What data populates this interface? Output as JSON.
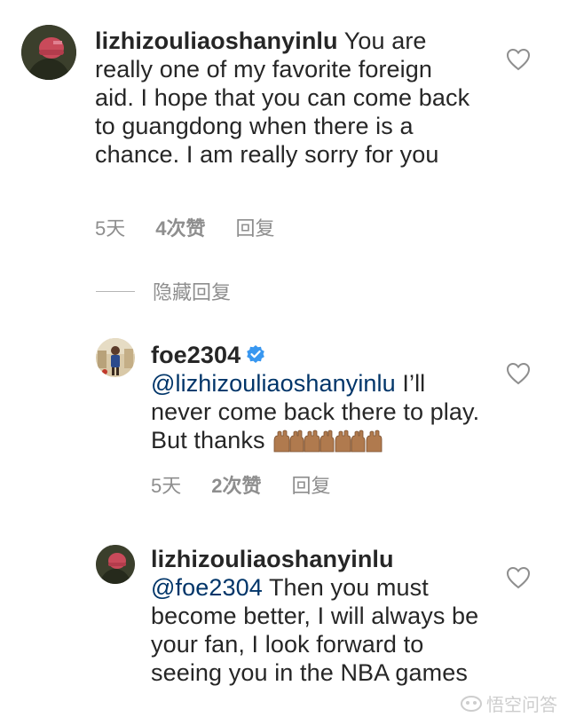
{
  "comments": [
    {
      "username": "lizhizouliaoshanyinlu",
      "mention": "",
      "text": "You are really one of my favorite foreign aid. I hope that you can come back to guangdong when there is a chance. I am really sorry for you",
      "time": "5天",
      "likes": "4次赞",
      "reply": "回复"
    },
    {
      "username": "foe2304",
      "verified": true,
      "mention": "@lizhizouliaoshanyinlu",
      "text": "I’ll never come back there to play. But thanks",
      "emoji": "raising-hands-emoji",
      "time": "5天",
      "likes": "2次赞",
      "reply": "回复"
    },
    {
      "username": "lizhizouliaoshanyinlu",
      "mention": "@foe2304",
      "text": "Then you must become better, I will always be your fan, I look forward to seeing you in the NBA games"
    }
  ],
  "hide_replies": "隐藏回复",
  "watermark": "悟空问答",
  "icons": {
    "like": "heart-outline-icon",
    "verified": "verified-badge-icon",
    "watermark": "wukong-logo-icon"
  },
  "colors": {
    "text": "#262626",
    "meta": "#8e8e8e",
    "mention": "#003569",
    "verified": "#3897f0"
  }
}
